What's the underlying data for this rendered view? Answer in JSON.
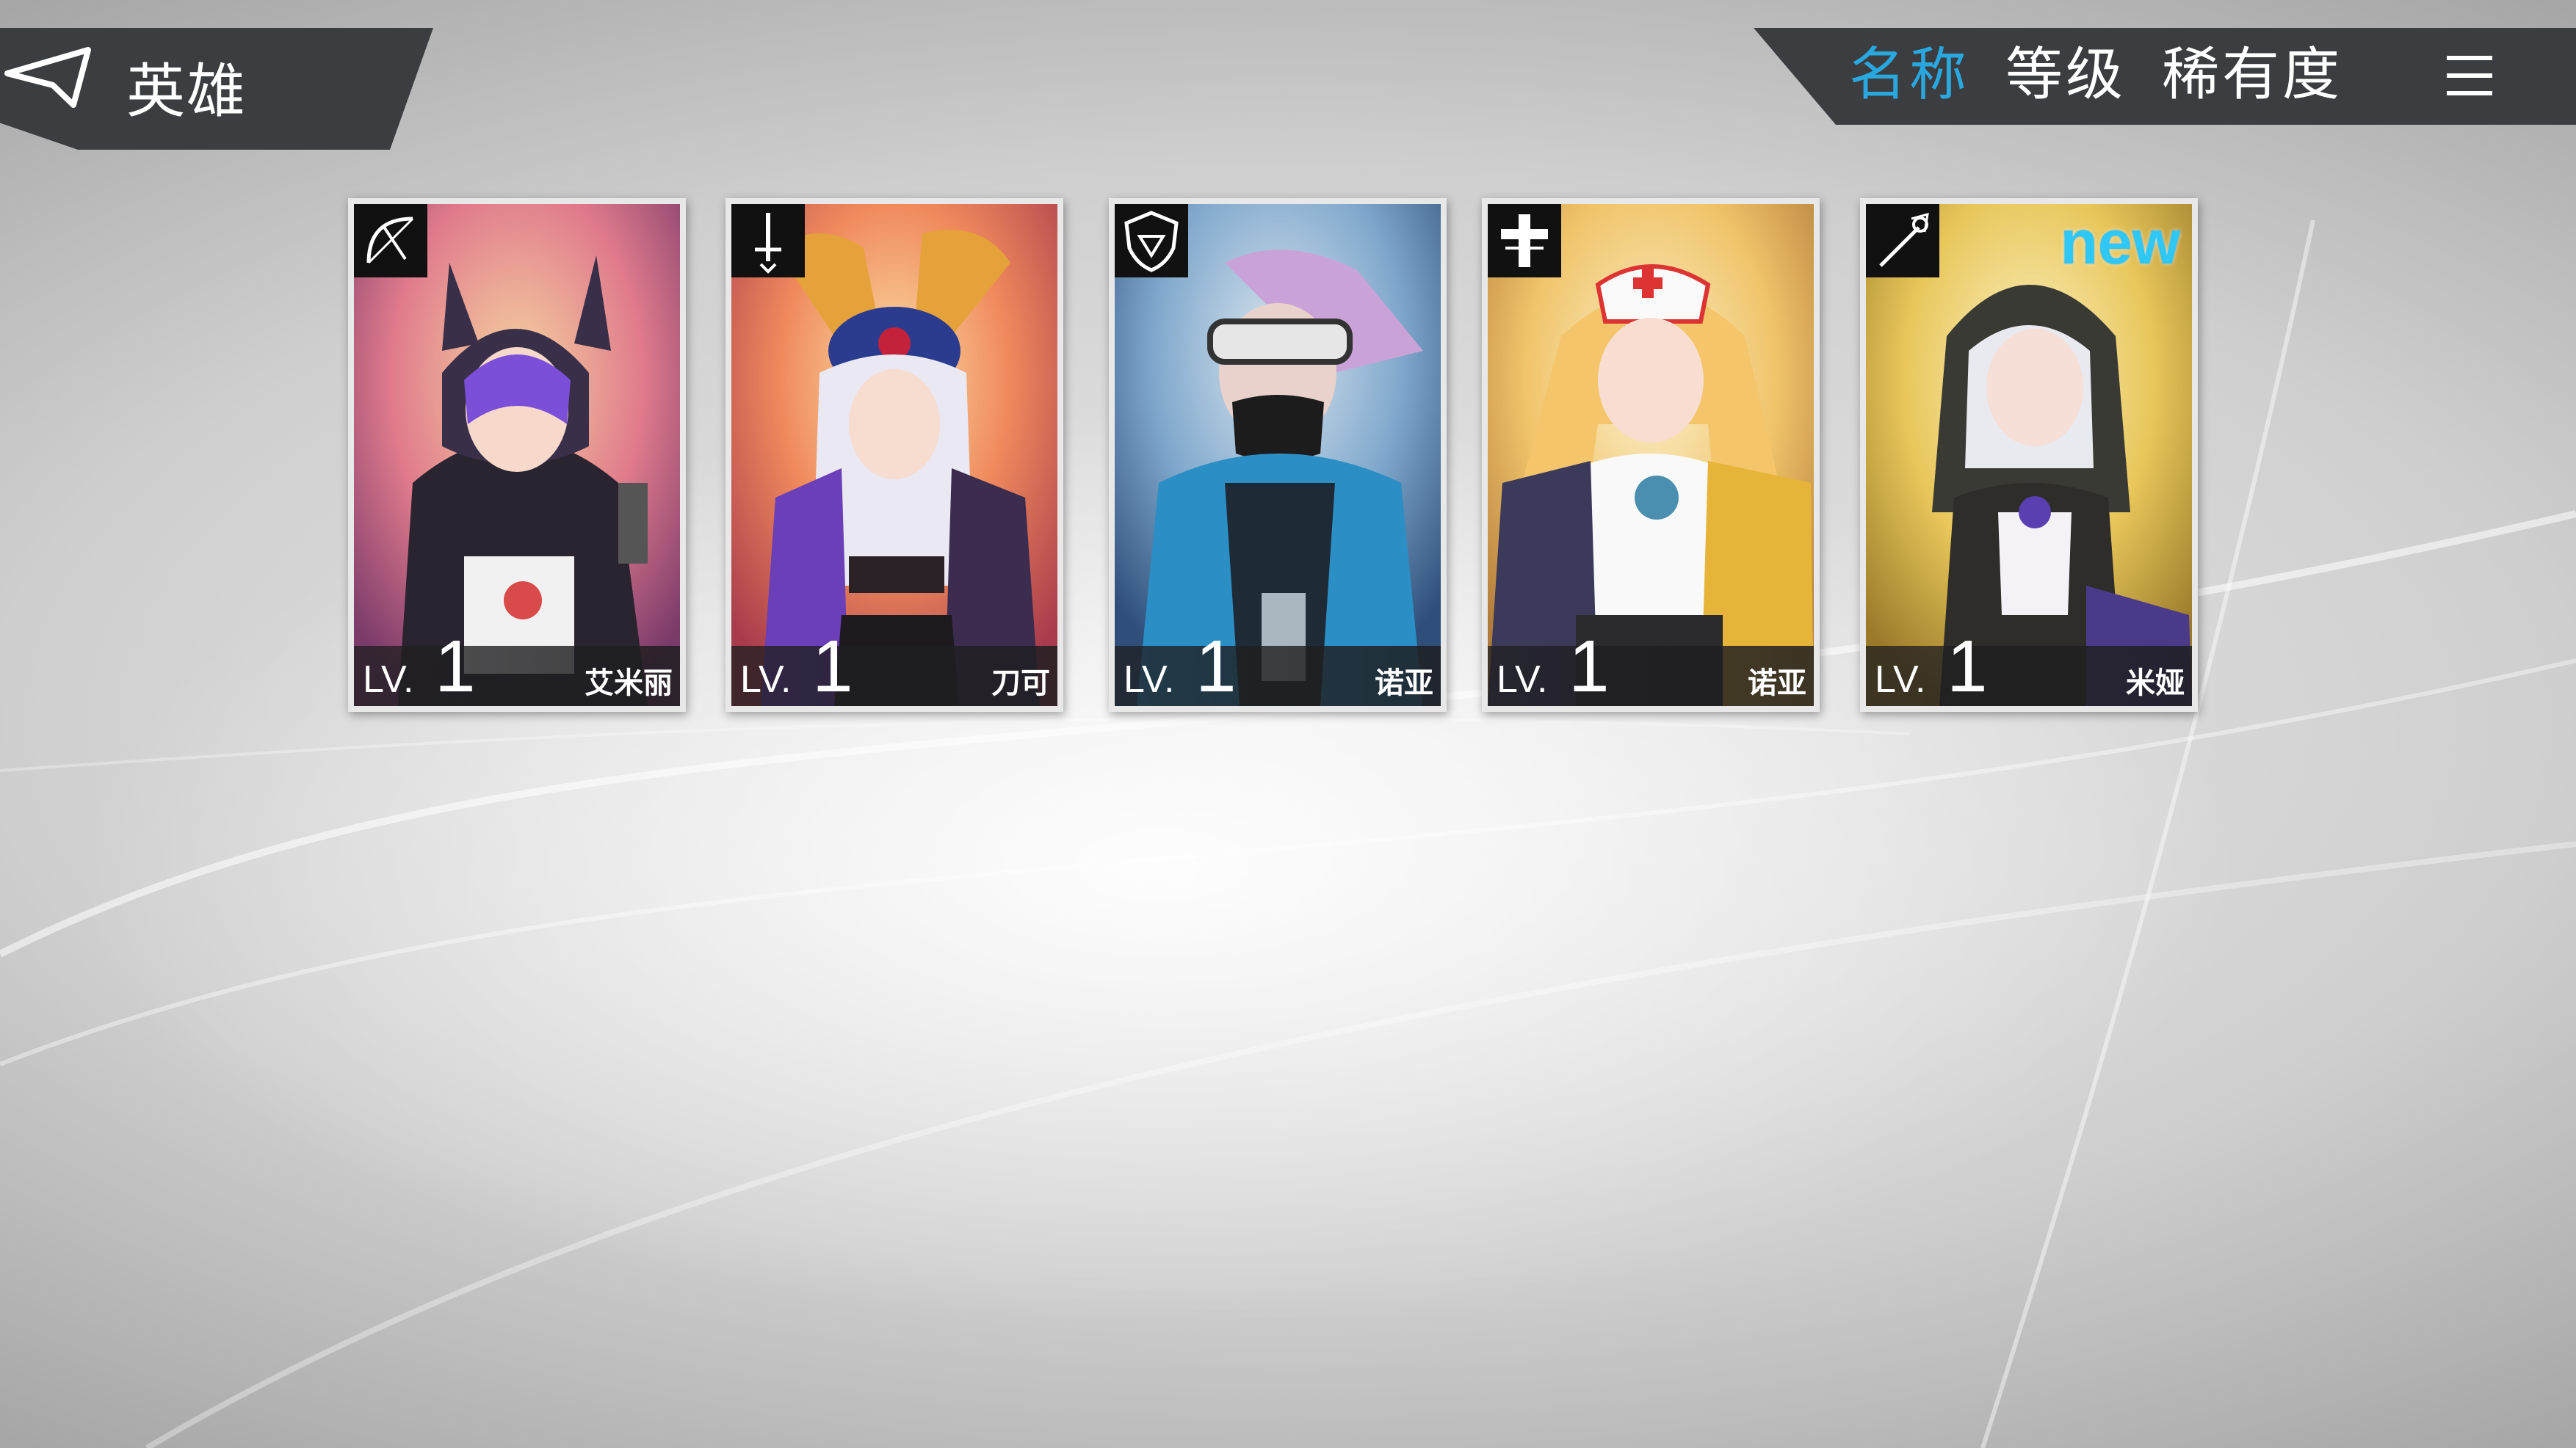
{
  "header": {
    "title": "英雄"
  },
  "sort": {
    "tabs": [
      {
        "label": "名称",
        "active": true
      },
      {
        "label": "等级",
        "active": false
      },
      {
        "label": "稀有度",
        "active": false
      }
    ],
    "accent_color": "#29a8e0"
  },
  "heroes": [
    {
      "name": "艾米丽",
      "level_label": "LV.",
      "level": "1",
      "class_icon": "bow-icon",
      "is_new": false
    },
    {
      "name": "刀可",
      "level_label": "LV.",
      "level": "1",
      "class_icon": "sword-icon",
      "is_new": false
    },
    {
      "name": "诺亚",
      "level_label": "LV.",
      "level": "1",
      "class_icon": "shield-icon",
      "is_new": false
    },
    {
      "name": "诺亚",
      "level_label": "LV.",
      "level": "1",
      "class_icon": "medic-cross-icon",
      "is_new": false
    },
    {
      "name": "米娅",
      "level_label": "LV.",
      "level": "1",
      "class_icon": "staff-icon",
      "is_new": true,
      "badge": "new"
    }
  ]
}
